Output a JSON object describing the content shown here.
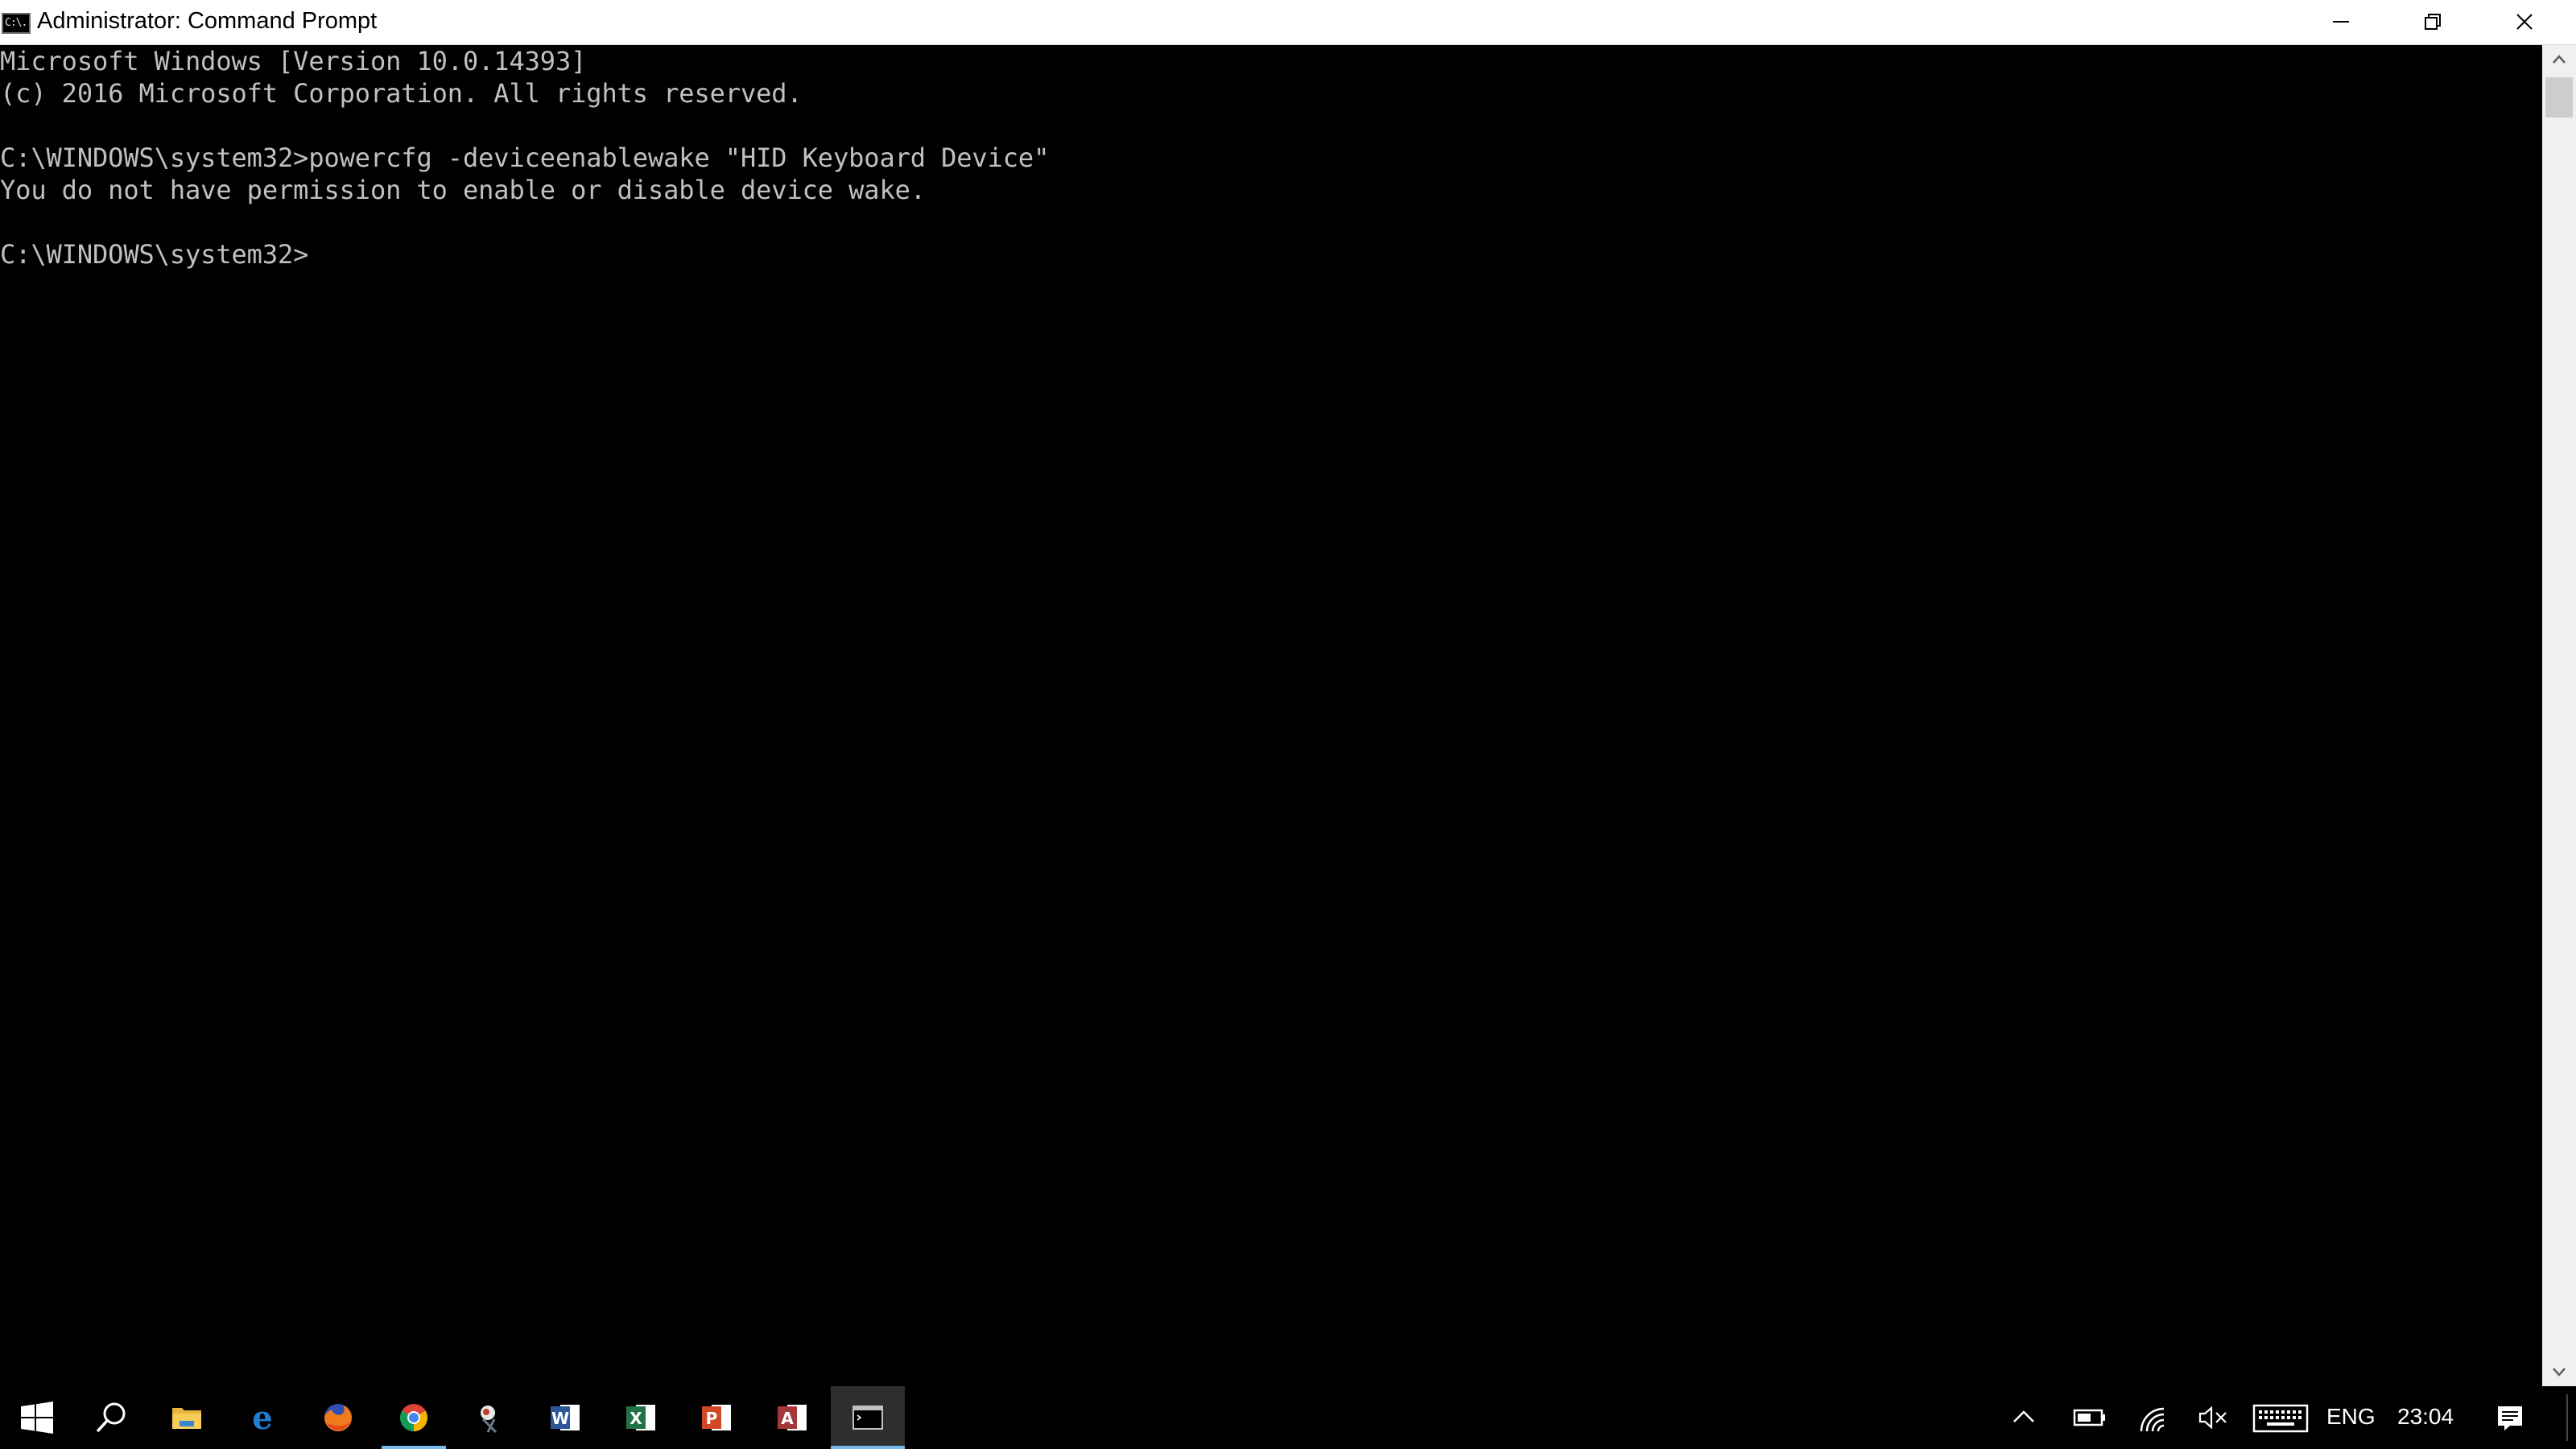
{
  "window": {
    "title": "Administrator: Command Prompt",
    "icon": "cmd-icon",
    "icon_glyph": "C:\\."
  },
  "controls": {
    "minimize": "minimize-icon",
    "maximize": "restore-icon",
    "close": "close-icon"
  },
  "console": {
    "lines": [
      "Microsoft Windows [Version 10.0.14393]",
      "(c) 2016 Microsoft Corporation. All rights reserved.",
      "C:\\WINDOWS\\system32>powercfg -deviceenablewake \"HID Keyboard Device\"",
      "You do not have permission to enable or disable device wake.",
      "C:\\WINDOWS\\system32>"
    ],
    "text_color": "#c0c0c0",
    "background": "#000000"
  },
  "taskbar": {
    "pinned": [
      {
        "name": "start-button",
        "icon": "windows-logo-icon"
      },
      {
        "name": "search-button",
        "icon": "search-icon"
      },
      {
        "name": "file-explorer",
        "icon": "folder-icon"
      },
      {
        "name": "edge",
        "icon": "edge-icon"
      },
      {
        "name": "firefox",
        "icon": "firefox-icon"
      },
      {
        "name": "chrome",
        "icon": "chrome-icon",
        "running": true
      },
      {
        "name": "snipping-tool",
        "icon": "snipping-tool-icon"
      },
      {
        "name": "word",
        "icon": "word-icon"
      },
      {
        "name": "excel",
        "icon": "excel-icon"
      },
      {
        "name": "powerpoint",
        "icon": "powerpoint-icon"
      },
      {
        "name": "access",
        "icon": "access-icon"
      },
      {
        "name": "command-prompt",
        "icon": "cmd-icon",
        "active": true
      }
    ],
    "tray": {
      "language": "ENG",
      "time": "23:04"
    },
    "accent_color": "#76b9ed"
  }
}
